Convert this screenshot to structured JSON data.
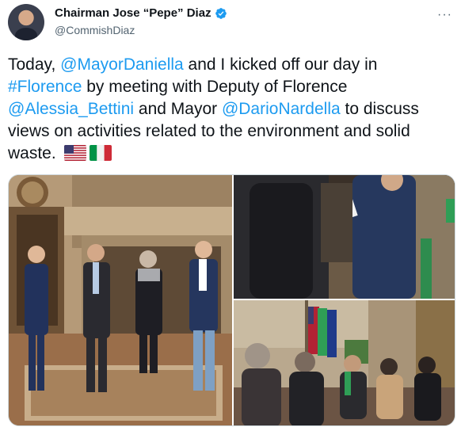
{
  "tweet": {
    "author_name": "Chairman Jose “Pepe” Diaz",
    "handle": "@CommishDiaz",
    "text_parts": {
      "t1": "Today, ",
      "m1": "@MayorDaniella",
      "t2": " and I kicked off our day in ",
      "h1": "#Florence",
      "t3": " by meeting with Deputy of Florence ",
      "m2": "@Alessia_Bettini",
      "t4": " and Mayor ",
      "m3": "@DarioNardella",
      "t5": " to discuss views on activities related to the environment and solid waste. "
    },
    "more_glyph": "···"
  },
  "icons": {
    "verified": "verified-badge-icon",
    "more": "more-options-icon",
    "flag1": "us-flag-icon",
    "flag2": "italy-flag-icon"
  },
  "colors": {
    "link": "#1d9bf0",
    "text": "#0f1419",
    "secondary": "#536471",
    "verified": "#1d9bf0"
  }
}
